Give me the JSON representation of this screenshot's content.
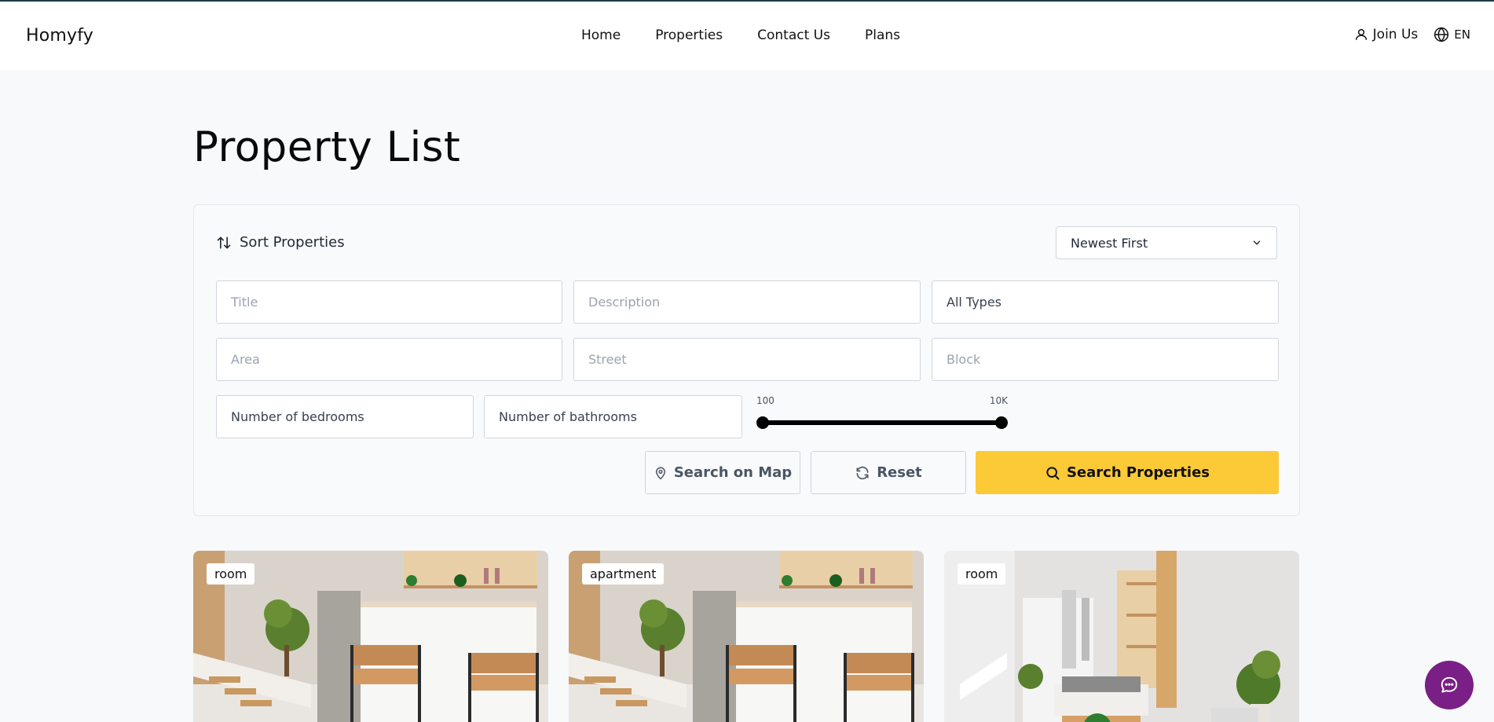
{
  "header": {
    "logo": "Homyfy",
    "nav": [
      "Home",
      "Properties",
      "Contact Us",
      "Plans"
    ],
    "join_label": "Join Us",
    "lang_label": "EN"
  },
  "page_title": "Property List",
  "filters": {
    "sort_label": "Sort Properties",
    "sort_value": "Newest First",
    "title_placeholder": "Title",
    "description_placeholder": "Description",
    "type_value": "All Types",
    "area_placeholder": "Area",
    "street_placeholder": "Street",
    "block_placeholder": "Block",
    "bedrooms_placeholder": "Number of bedrooms",
    "bathrooms_placeholder": "Number of bathrooms",
    "price_min_label": "100",
    "price_max_label": "10K",
    "search_map_label": "Search on Map",
    "reset_label": "Reset",
    "search_label": "Search Properties"
  },
  "cards": [
    {
      "type": "room",
      "scene": "kitchen"
    },
    {
      "type": "apartment",
      "scene": "kitchen"
    },
    {
      "type": "room",
      "scene": "loft"
    }
  ],
  "colors": {
    "accent": "#fcc937",
    "chat": "#7a1f86",
    "topline": "#1f3a4d"
  }
}
